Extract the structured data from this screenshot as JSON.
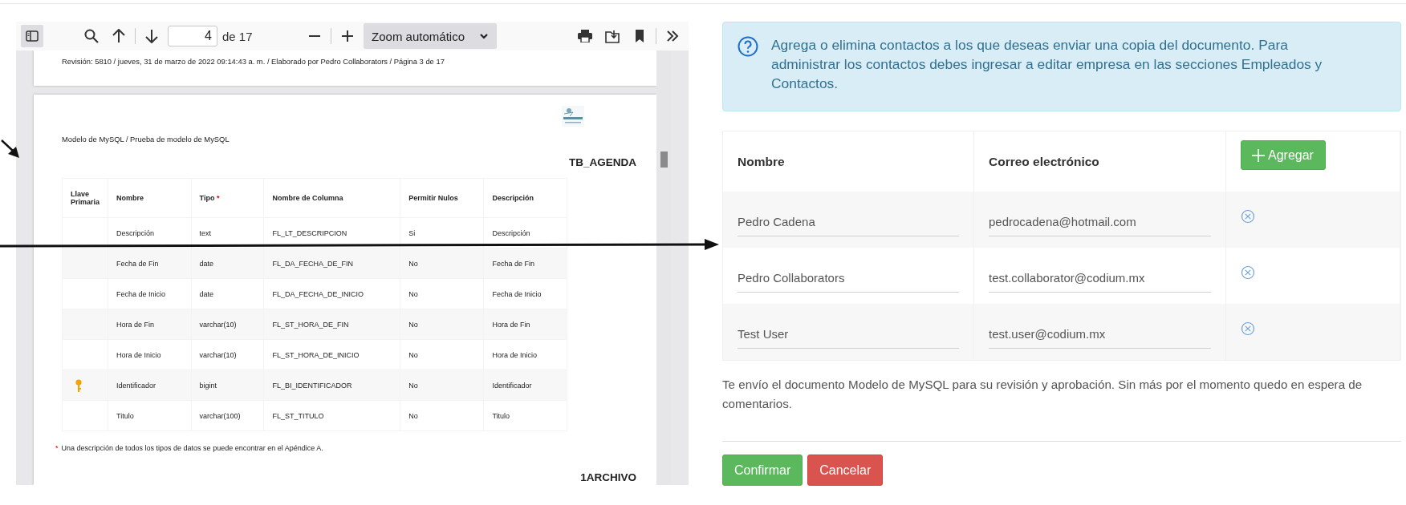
{
  "pdf_viewer": {
    "toolbar": {
      "sidebar_open": true,
      "page_number": "4",
      "page_count": "de 17",
      "zoom": "Zoom automático"
    },
    "previous_page_footer": "Revisión: 5810 / jueves, 31 de marzo de 2022 09:14:43 a. m. / Elaborado por Pedro Collaborators / Página 3 de 17",
    "page": {
      "breadcrumb": "Modelo de MySQL / Prueba de modelo de MySQL",
      "table_title": "TB_AGENDA",
      "columns": [
        {
          "label": "Llave Primaria"
        },
        {
          "label": "Nombre"
        },
        {
          "label": "Tipo",
          "required_mark": "*"
        },
        {
          "label": "Nombre de Columna"
        },
        {
          "label": "Permitir Nulos"
        },
        {
          "label": "Descripción"
        }
      ],
      "rows": [
        {
          "primary_key": false,
          "cells": [
            "",
            "Descripción",
            "text",
            "FL_LT_DESCRIPCION",
            "Si",
            "Descripción"
          ]
        },
        {
          "primary_key": false,
          "cells": [
            "",
            "Fecha de Fin",
            "date",
            "FL_DA_FECHA_DE_FIN",
            "No",
            "Fecha de Fin"
          ]
        },
        {
          "primary_key": false,
          "cells": [
            "",
            "Fecha de Inicio",
            "date",
            "FL_DA_FECHA_DE_INICIO",
            "No",
            "Fecha de Inicio"
          ]
        },
        {
          "primary_key": false,
          "cells": [
            "",
            "Hora de Fin",
            "varchar(10)",
            "FL_ST_HORA_DE_FIN",
            "No",
            "Hora de Fin"
          ]
        },
        {
          "primary_key": false,
          "cells": [
            "",
            "Hora de Inicio",
            "varchar(10)",
            "FL_ST_HORA_DE_INICIO",
            "No",
            "Hora de Inicio"
          ]
        },
        {
          "primary_key": true,
          "cells": [
            "",
            "Identificador",
            "bigint",
            "FL_BI_IDENTIFICADOR",
            "No",
            "Identificador"
          ]
        },
        {
          "primary_key": false,
          "cells": [
            "",
            "Titulo",
            "varchar(100)",
            "FL_ST_TITULO",
            "No",
            "Titulo"
          ]
        }
      ],
      "footnote": {
        "mark": "*",
        "text": "Una descripción de todos los tipos de datos se puede encontrar en el Apéndice A."
      },
      "next_table_title": "1ARCHIVO"
    }
  },
  "contacts": {
    "info": "Agrega o elimina contactos a los que deseas enviar una copia del documento. Para administrar los contactos debes ingresar a editar empresa en las secciones Empleados y Contactos.",
    "columns": [
      "Nombre",
      "Correo electrónico"
    ],
    "add_button": "Agregar",
    "rows": [
      {
        "name": "Pedro Cadena",
        "email": "pedrocadena@hotmail.com"
      },
      {
        "name": "Pedro Collaborators",
        "email": "test.collaborator@codium.mx"
      },
      {
        "name": "Test User",
        "email": "test.user@codium.mx"
      }
    ],
    "message": "Te envío el documento Modelo de MySQL para su revisión y aprobación. Sin más por el momento quedo en espera de comentarios.",
    "buttons": [
      {
        "kind": "confirm",
        "label": "Confirmar"
      },
      {
        "kind": "cancel",
        "label": "Cancelar"
      }
    ]
  }
}
